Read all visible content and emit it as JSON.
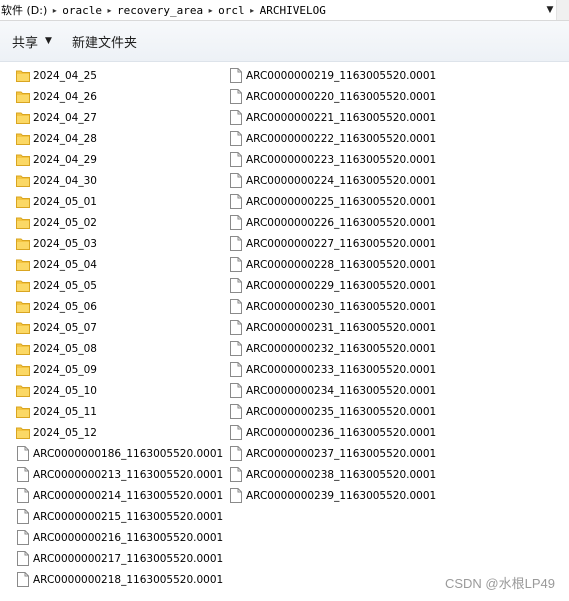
{
  "breadcrumb": {
    "root": "软件 (D:)",
    "parts": [
      "oracle",
      "recovery_area",
      "orcl",
      "ARCHIVELOG"
    ]
  },
  "toolbar": {
    "share_label": "共享",
    "new_folder_label": "新建文件夹"
  },
  "column1": [
    {
      "name": "2024_04_25",
      "type": "folder"
    },
    {
      "name": "2024_04_26",
      "type": "folder"
    },
    {
      "name": "2024_04_27",
      "type": "folder"
    },
    {
      "name": "2024_04_28",
      "type": "folder"
    },
    {
      "name": "2024_04_29",
      "type": "folder"
    },
    {
      "name": "2024_04_30",
      "type": "folder"
    },
    {
      "name": "2024_05_01",
      "type": "folder"
    },
    {
      "name": "2024_05_02",
      "type": "folder"
    },
    {
      "name": "2024_05_03",
      "type": "folder"
    },
    {
      "name": "2024_05_04",
      "type": "folder"
    },
    {
      "name": "2024_05_05",
      "type": "folder"
    },
    {
      "name": "2024_05_06",
      "type": "folder"
    },
    {
      "name": "2024_05_07",
      "type": "folder"
    },
    {
      "name": "2024_05_08",
      "type": "folder"
    },
    {
      "name": "2024_05_09",
      "type": "folder"
    },
    {
      "name": "2024_05_10",
      "type": "folder"
    },
    {
      "name": "2024_05_11",
      "type": "folder"
    },
    {
      "name": "2024_05_12",
      "type": "folder"
    },
    {
      "name": "ARC0000000186_1163005520.0001",
      "type": "file"
    },
    {
      "name": "ARC0000000213_1163005520.0001",
      "type": "file"
    },
    {
      "name": "ARC0000000214_1163005520.0001",
      "type": "file"
    },
    {
      "name": "ARC0000000215_1163005520.0001",
      "type": "file"
    },
    {
      "name": "ARC0000000216_1163005520.0001",
      "type": "file"
    },
    {
      "name": "ARC0000000217_1163005520.0001",
      "type": "file"
    },
    {
      "name": "ARC0000000218_1163005520.0001",
      "type": "file"
    }
  ],
  "column2": [
    {
      "name": "ARC0000000219_1163005520.0001",
      "type": "file"
    },
    {
      "name": "ARC0000000220_1163005520.0001",
      "type": "file"
    },
    {
      "name": "ARC0000000221_1163005520.0001",
      "type": "file"
    },
    {
      "name": "ARC0000000222_1163005520.0001",
      "type": "file"
    },
    {
      "name": "ARC0000000223_1163005520.0001",
      "type": "file"
    },
    {
      "name": "ARC0000000224_1163005520.0001",
      "type": "file"
    },
    {
      "name": "ARC0000000225_1163005520.0001",
      "type": "file"
    },
    {
      "name": "ARC0000000226_1163005520.0001",
      "type": "file"
    },
    {
      "name": "ARC0000000227_1163005520.0001",
      "type": "file"
    },
    {
      "name": "ARC0000000228_1163005520.0001",
      "type": "file"
    },
    {
      "name": "ARC0000000229_1163005520.0001",
      "type": "file"
    },
    {
      "name": "ARC0000000230_1163005520.0001",
      "type": "file"
    },
    {
      "name": "ARC0000000231_1163005520.0001",
      "type": "file"
    },
    {
      "name": "ARC0000000232_1163005520.0001",
      "type": "file"
    },
    {
      "name": "ARC0000000233_1163005520.0001",
      "type": "file"
    },
    {
      "name": "ARC0000000234_1163005520.0001",
      "type": "file"
    },
    {
      "name": "ARC0000000235_1163005520.0001",
      "type": "file"
    },
    {
      "name": "ARC0000000236_1163005520.0001",
      "type": "file"
    },
    {
      "name": "ARC0000000237_1163005520.0001",
      "type": "file"
    },
    {
      "name": "ARC0000000238_1163005520.0001",
      "type": "file"
    },
    {
      "name": "ARC0000000239_1163005520.0001",
      "type": "file"
    }
  ],
  "watermark": "CSDN @水根LP49",
  "colors": {
    "folder": "#f4c542",
    "folder_dark": "#d9a521",
    "file_border": "#8a8a8a"
  }
}
